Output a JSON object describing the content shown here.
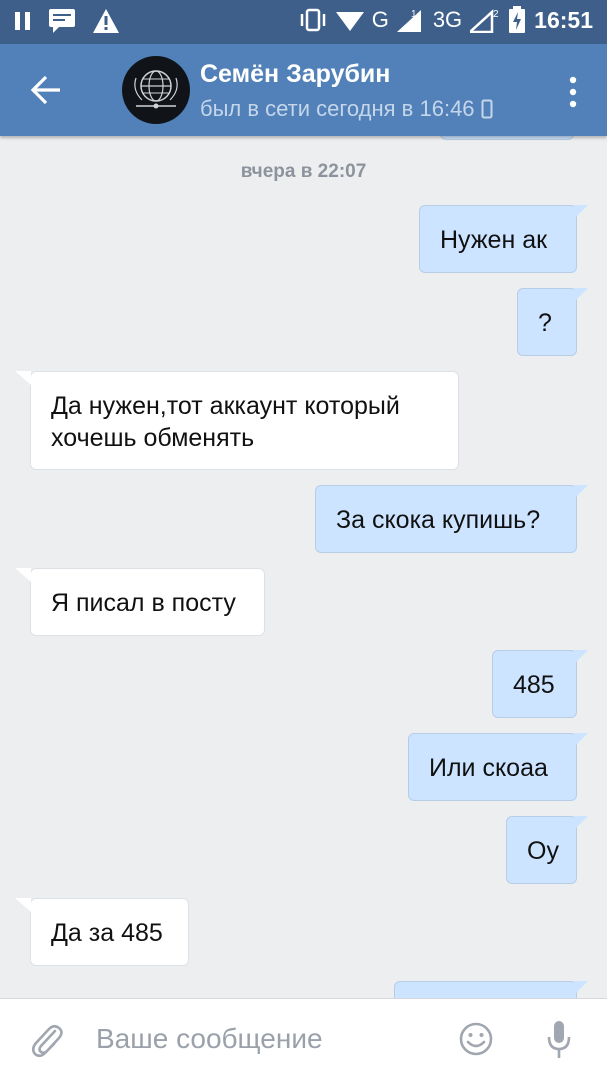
{
  "status_bar": {
    "time": "16:51",
    "network_g": "G",
    "network_3g": "3G",
    "sim1": "1",
    "sim2": "2"
  },
  "header": {
    "contact_name": "Семён Зарубин",
    "status": "был в сети сегодня в 16:46"
  },
  "chat": {
    "date_separator": "вчера в 22:07",
    "messages": [
      {
        "dir": "out",
        "text": "Нужен ак"
      },
      {
        "dir": "out",
        "text": "?"
      },
      {
        "dir": "in",
        "text": "Да нужен,тот аккаунт который хочешь обменять"
      },
      {
        "dir": "out",
        "text": "За скока купишь?"
      },
      {
        "dir": "in",
        "text": "Я писал в посту"
      },
      {
        "dir": "out",
        "text": "485"
      },
      {
        "dir": "out",
        "text": "Или скоаа"
      },
      {
        "dir": "out",
        "text": "Оу"
      },
      {
        "dir": "in",
        "text": "Да за 485"
      }
    ]
  },
  "composer": {
    "placeholder": "Ваше сообщение"
  },
  "colors": {
    "header": "#5181b8",
    "status_bar": "#3d5f8a",
    "outgoing_bubble": "#cce4ff",
    "incoming_bubble": "#ffffff",
    "background": "#edeef0"
  },
  "icons": [
    "pause-icon",
    "message-icon",
    "warning-icon",
    "vibrate-icon",
    "wifi-icon",
    "signal-icon",
    "battery-charging-icon",
    "back-arrow-icon",
    "more-icon",
    "mobile-icon",
    "attach-icon",
    "emoji-icon",
    "mic-icon"
  ]
}
